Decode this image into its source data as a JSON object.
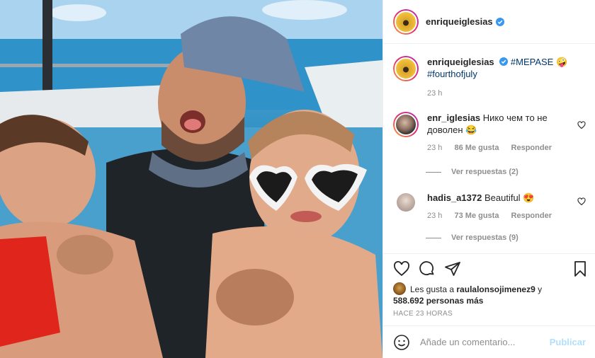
{
  "post": {
    "author": "enriqueiglesias",
    "photo_description_icon": "family-photo-in-pool"
  },
  "caption": {
    "username": "enriqueiglesias",
    "hashtag1": "#MEPASE",
    "emoji1": "🤪",
    "hashtag2": "#fourthofjuly",
    "time": "23 h"
  },
  "comments": [
    {
      "username": "enr_iglesias",
      "text": "Нико чем то не доволен 😂",
      "time": "23 h",
      "likes": "86 Me gusta",
      "reply": "Responder",
      "replies": "Ver respuestas (2)"
    },
    {
      "username": "hadis_a1372",
      "text": "Beautiful 😍",
      "time": "23 h",
      "likes": "73 Me gusta",
      "reply": "Responder",
      "replies": "Ver respuestas (9)"
    }
  ],
  "likes": {
    "prefix": "Les gusta a",
    "user": "raulalonsojimenez9",
    "connector": "y",
    "count": "588.692 personas más"
  },
  "timeago": "HACE 23 HORAS",
  "composer": {
    "placeholder": "Añade un comentario...",
    "publish": "Publicar"
  },
  "colors": {
    "verified": "#3897f0",
    "link": "#00376b",
    "publish_disabled": "#b2dffc"
  }
}
